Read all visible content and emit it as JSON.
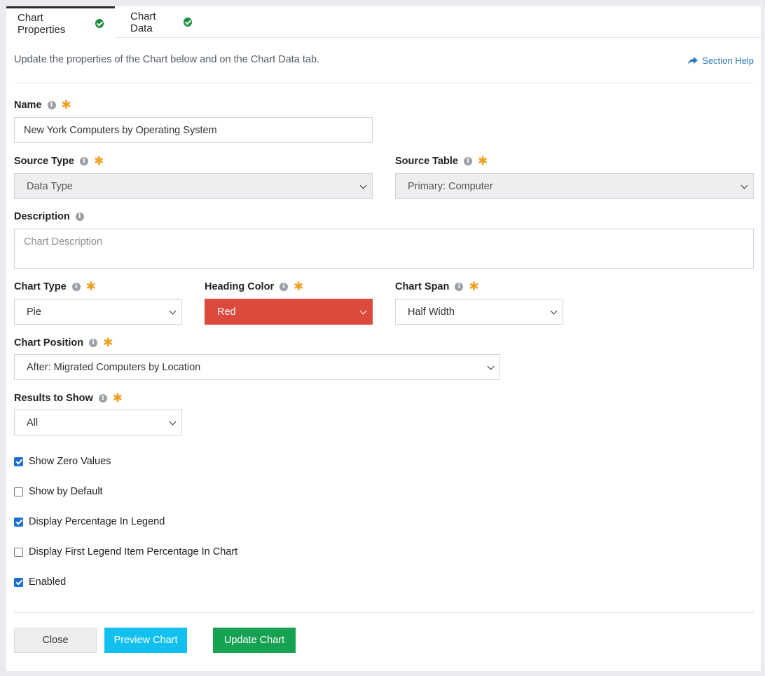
{
  "tabs": [
    {
      "label": "Chart Properties",
      "active": true
    },
    {
      "label": "Chart Data",
      "active": false
    }
  ],
  "intro_text": "Update the properties of the Chart below and on the Chart Data tab.",
  "section_help": "Section Help",
  "fields": {
    "name": {
      "label": "Name",
      "value": "New York Computers by Operating System"
    },
    "source_type": {
      "label": "Source Type",
      "value": "Data Type"
    },
    "source_table": {
      "label": "Source Table",
      "value": "Primary: Computer"
    },
    "description": {
      "label": "Description",
      "placeholder": "Chart Description"
    },
    "chart_type": {
      "label": "Chart Type",
      "value": "Pie"
    },
    "heading_color": {
      "label": "Heading Color",
      "value": "Red",
      "color": "#dc4a3d"
    },
    "chart_span": {
      "label": "Chart Span",
      "value": "Half Width"
    },
    "chart_position": {
      "label": "Chart Position",
      "value": "After: Migrated Computers by Location"
    },
    "results_to_show": {
      "label": "Results to Show",
      "value": "All"
    }
  },
  "checkboxes": [
    {
      "label": "Show Zero Values",
      "checked": true
    },
    {
      "label": "Show by Default",
      "checked": false
    },
    {
      "label": "Display Percentage In Legend",
      "checked": true
    },
    {
      "label": "Display First Legend Item Percentage In Chart",
      "checked": false
    },
    {
      "label": "Enabled",
      "checked": true
    }
  ],
  "buttons": {
    "close": "Close",
    "preview": "Preview Chart",
    "update": "Update Chart"
  },
  "colors": {
    "accent_blue": "#2a7ab8",
    "required": "#f0a020",
    "preview_button": "#11c0ef",
    "update_button": "#16a252",
    "tab_check": "#1e8e3e"
  }
}
